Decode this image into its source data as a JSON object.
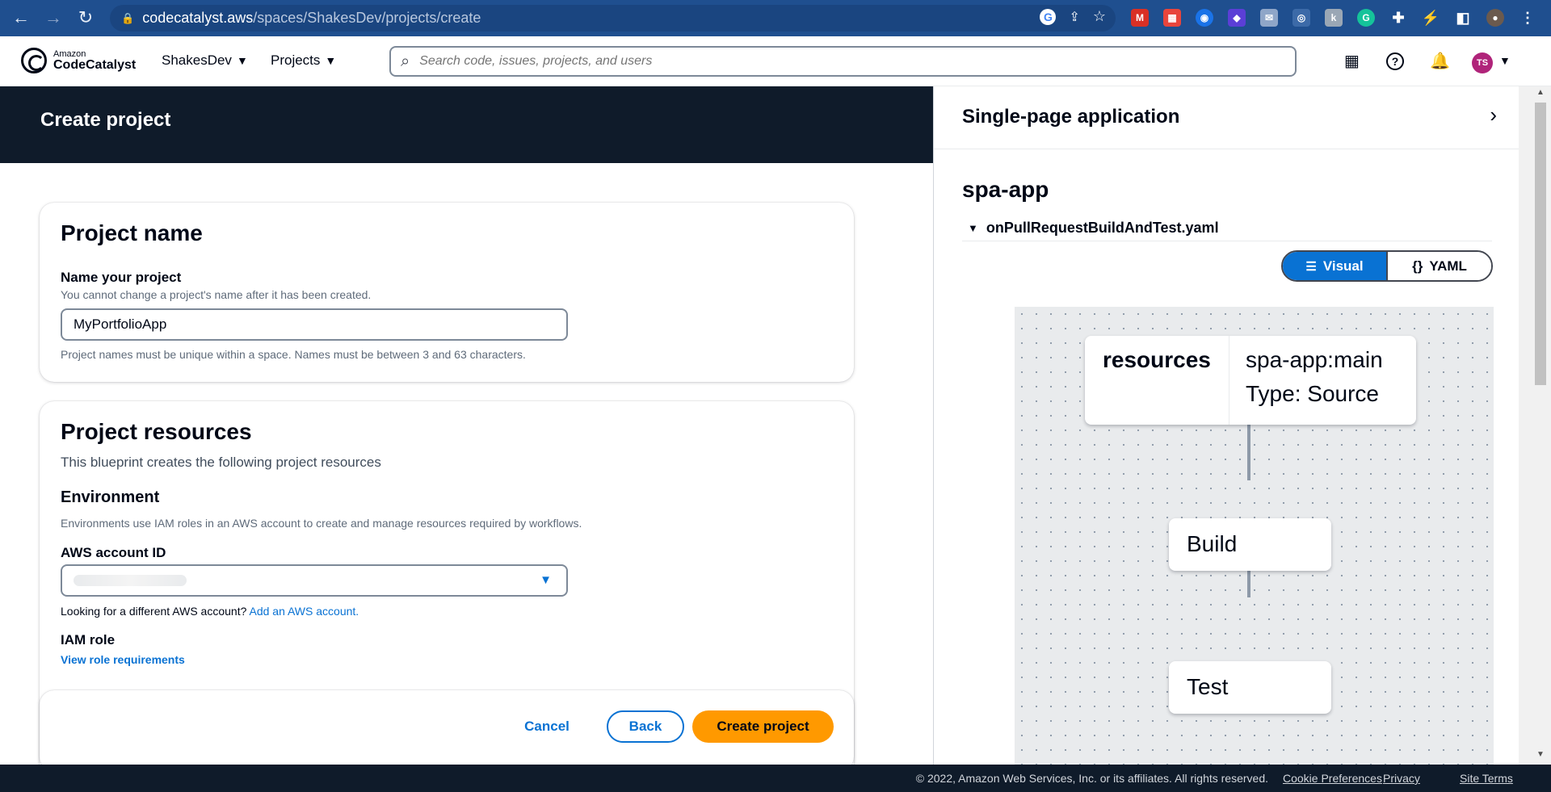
{
  "browser": {
    "url_host": "codecatalyst.aws",
    "url_path": "/spaces/ShakesDev/projects/create"
  },
  "header": {
    "logo_small": "Amazon",
    "logo_big": "CodeCatalyst",
    "space_menu": "ShakesDev",
    "projects_menu": "Projects",
    "search_placeholder": "Search code, issues, projects, and users",
    "avatar_initials": "TS"
  },
  "page": {
    "title": "Create project"
  },
  "project_name_card": {
    "heading": "Project name",
    "field_label": "Name your project",
    "field_description": "You cannot change a project's name after it has been created.",
    "field_value": "MyPortfolioApp",
    "constraint_text": "Project names must be unique within a space. Names must be between 3 and 63 characters."
  },
  "resources_card": {
    "heading": "Project resources",
    "subtitle": "This blueprint creates the following project resources",
    "env_heading": "Environment",
    "env_description": "Environments use IAM roles in an AWS account to create and manage resources required by workflows.",
    "account_label": "AWS account ID",
    "account_help_prefix": "Looking for a different AWS account?",
    "account_help_link": "Add an AWS account.",
    "iam_label": "IAM role",
    "iam_link": "View role requirements"
  },
  "actions": {
    "cancel": "Cancel",
    "back": "Back",
    "create": "Create project"
  },
  "side_panel": {
    "title": "Single-page application",
    "repo_name": "spa-app",
    "workflow_file": "onPullRequestBuildAndTest.yaml",
    "view_visual": "Visual",
    "view_yaml": "YAML",
    "nodes": {
      "source_label": "resources",
      "source_name": "spa-app:main",
      "source_type": "Type: Source",
      "build": "Build",
      "test": "Test"
    }
  },
  "footer": {
    "copyright": "© 2022, Amazon Web Services, Inc. or its affiliates. All rights reserved.",
    "cookie": "Cookie Preferences",
    "privacy": "Privacy",
    "terms": "Site Terms"
  },
  "colors": {
    "primary": "#0972d3",
    "create_button": "#ff9900",
    "banner": "#0f1b2a",
    "browser_bar": "#1f4f8f"
  }
}
